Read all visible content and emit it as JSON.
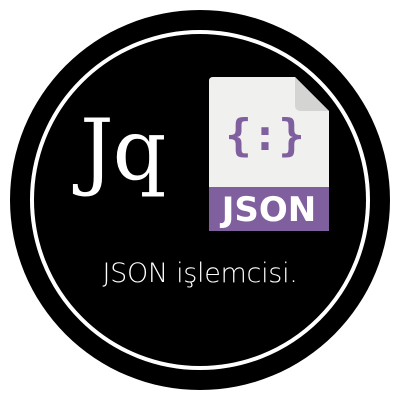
{
  "logo": {
    "monogram": "Jq",
    "file_badge_label": "JSON",
    "file_braces": "{:}"
  },
  "caption": "JSON işlemcisi.",
  "colors": {
    "background": "#000000",
    "ring": "#ffffff",
    "paper": "#f0f0ee",
    "paper_fold": "#d4d4d2",
    "accent": "#7f5f9d"
  },
  "icons": {
    "file": "json-file-icon"
  }
}
